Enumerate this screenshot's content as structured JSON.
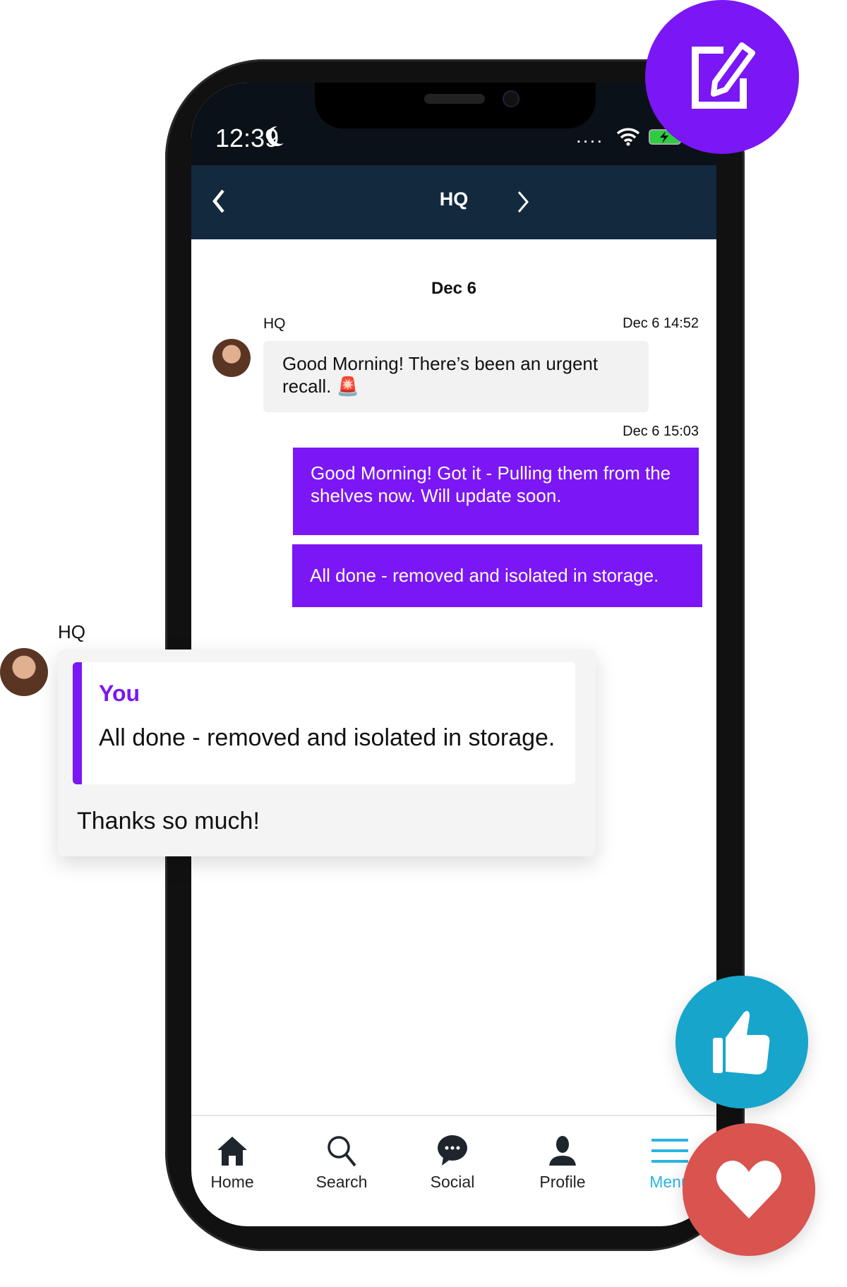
{
  "status_bar": {
    "time": "12:39",
    "signal": "....",
    "icons": [
      "moon-icon",
      "wifi-icon",
      "battery-charging-icon"
    ]
  },
  "header": {
    "title": "HQ",
    "back_icon": "chevron-left-icon",
    "forward_icon": "chevron-right-icon"
  },
  "chat": {
    "date_divider": "Dec 6",
    "messages": [
      {
        "sender": "HQ",
        "timestamp": "Dec 6 14:52",
        "text": "Good Morning! There’s been an urgent recall. 🚨",
        "outgoing": false
      },
      {
        "timestamp": "Dec 6 15:03",
        "text": "Good Morning! Got it - Pulling them from the shelves now. Will update soon.",
        "outgoing": true
      },
      {
        "text": "All done - removed and isolated in storage.",
        "outgoing": true
      }
    ]
  },
  "floating_reply": {
    "sender": "HQ",
    "quote_author": "You",
    "quote_text": "All done - removed and isolated in storage.",
    "reply_text": "Thanks so much!"
  },
  "bottom_nav": {
    "items": [
      {
        "label": "Home"
      },
      {
        "label": "Search"
      },
      {
        "label": "Social"
      },
      {
        "label": "Profile"
      },
      {
        "label": "Menu",
        "active": true
      }
    ]
  },
  "colors": {
    "accent_purple": "#7b16f5",
    "header_navy": "#132a3e",
    "like_blue": "#17a5cc",
    "heart_red": "#d9534f",
    "menu_active": "#2bb5e3"
  }
}
